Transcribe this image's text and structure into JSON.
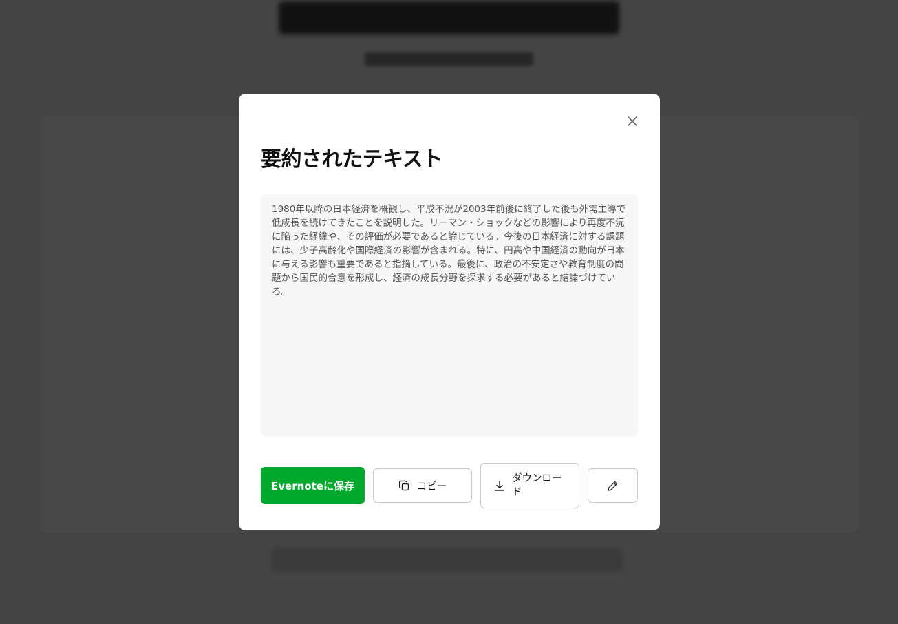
{
  "modal": {
    "title": "要約されたテキスト",
    "summary": "1980年以降の日本経済を概観し、平成不況が2003年前後に終了した後も外需主導で低成長を続けてきたことを説明した。リーマン・ショックなどの影響により再度不況に陥った経緯や、その評価が必要であると論じている。今後の日本経済に対する課題には、少子高齢化や国際経済の影響が含まれる。特に、円高や中国経済の動向が日本に与える影響も重要であると指摘している。最後に、政治の不安定さや教育制度の問題から国民的合意を形成し、経済の成長分野を探求する必要があると結論づけている。",
    "buttons": {
      "evernote": "Evernoteに保存",
      "copy": "コピー",
      "download": "ダウンロード"
    }
  },
  "icons": {
    "close": "close-icon",
    "copy": "copy-icon",
    "download": "download-icon",
    "edit": "pencil-icon"
  },
  "colors": {
    "evernote_green": "#00a82d",
    "overlay": "#484745",
    "summary_bg": "#f7f7f7"
  }
}
